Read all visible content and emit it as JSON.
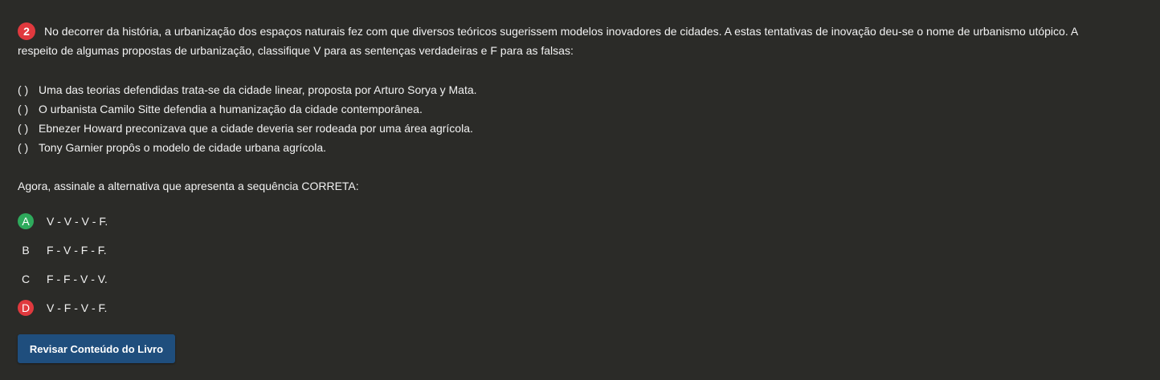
{
  "question": {
    "number": "2",
    "text_line1": "No decorrer da história, a urbanização dos espaços naturais fez com que diversos teóricos sugerissem modelos inovadores de cidades. A estas tentativas de inovação deu-se o nome de urbanismo utópico. A",
    "text_line2": "respeito de algumas propostas de urbanização, classifique V para as sentenças verdadeiras e F para as falsas:",
    "statements": [
      {
        "marker": "(   )",
        "text": "Uma das teorias defendidas trata-se da cidade linear, proposta por Arturo Sorya y Mata."
      },
      {
        "marker": "(   )",
        "text": "O urbanista Camilo Sitte defendia a humanização da cidade contemporânea."
      },
      {
        "marker": "(   )",
        "text": "Ebnezer Howard preconizava que a cidade deveria ser rodeada por uma área agrícola."
      },
      {
        "marker": "(   )",
        "text": "Tony Garnier propôs o modelo de cidade urbana agrícola."
      }
    ],
    "prompt": "Agora, assinale a alternativa que apresenta a sequência CORRETA:",
    "options": [
      {
        "letter": "A",
        "text": "V - V - V - F.",
        "status": "correct"
      },
      {
        "letter": "B",
        "text": "F - V - F - F.",
        "status": "none"
      },
      {
        "letter": "C",
        "text": "F - F - V - V.",
        "status": "none"
      },
      {
        "letter": "D",
        "text": "V - F - V - F.",
        "status": "wrong"
      }
    ]
  },
  "review_button_label": "Revisar Conteúdo do Livro",
  "colors": {
    "background": "#2b2b28",
    "correct": "#2eaa5c",
    "wrong": "#e0393e",
    "button": "#1f4e7d"
  }
}
